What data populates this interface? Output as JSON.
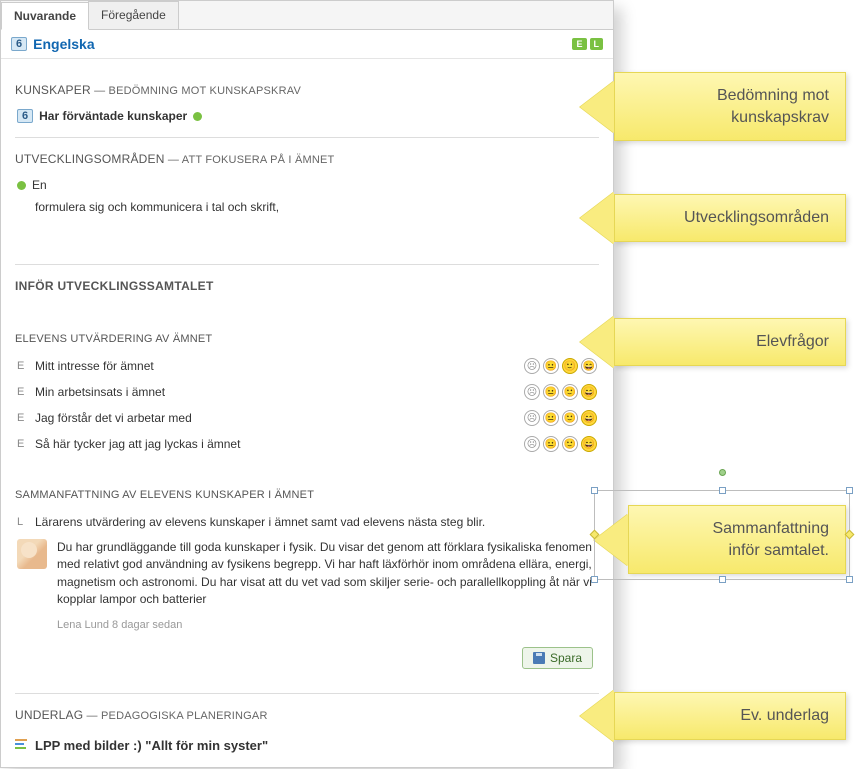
{
  "tabs": {
    "current": "Nuvarande",
    "previous": "Föregående"
  },
  "subject": {
    "grade": "6",
    "name": "Engelska",
    "tag_e": "E",
    "tag_l": "L"
  },
  "kunskaper": {
    "heading_strong": "KUNSKAPER",
    "heading_rest": " — BEDÖMNING MOT KUNSKAPSKRAV",
    "row_text": "Har förväntade kunskaper"
  },
  "utvomr": {
    "heading_strong": "UTVECKLINGSOMRÅDEN",
    "heading_rest": " — ATT FOKUSERA PÅ I ÄMNET",
    "item_en": "En",
    "item_text": "formulera sig och kommunicera i tal och skrift,"
  },
  "infor_heading": "INFÖR UTVECKLINGSSAMTALET",
  "elev_eval": {
    "heading": "ELEVENS UTVÄRDERING AV ÄMNET",
    "rows": [
      {
        "label": "Mitt intresse för ämnet"
      },
      {
        "label": "Min arbetsinsats i ämnet"
      },
      {
        "label": "Jag förstår det vi arbetar med"
      },
      {
        "label": "Så här tycker jag att jag lyckas i ämnet"
      }
    ]
  },
  "sammanf": {
    "heading": "SAMMANFATTNING AV ELEVENS KUNSKAPER I ÄMNET",
    "intro": "Lärarens utvärdering av elevens kunskaper i ämnet samt vad elevens nästa steg blir.",
    "body": "Du har grundläggande till goda kunskaper i fysik. Du visar det genom att förklara fysikaliska fenomen med relativt god användning av fysikens begrepp. Vi har haft läxförhör inom områdena ellära, energi, magnetism och astronomi. Du har visat att du vet vad som skiljer serie- och parallellkoppling åt när vi kopplar lampor och batterier",
    "meta": "Lena Lund 8 dagar sedan",
    "save": "Spara"
  },
  "underlag": {
    "heading_strong": "UNDERLAG",
    "heading_rest": " — PEDAGOGISKA PLANERINGAR",
    "item": "LPP med bilder :) \"Allt för min syster\""
  },
  "callouts": {
    "c1a": "Bedömning mot",
    "c1b": "kunskapskrav",
    "c2": "Utvecklingsområden",
    "c3": "Elevfrågor",
    "c4a": "Sammanfattning",
    "c4b": "inför samtalet.",
    "c5": "Ev. underlag"
  }
}
